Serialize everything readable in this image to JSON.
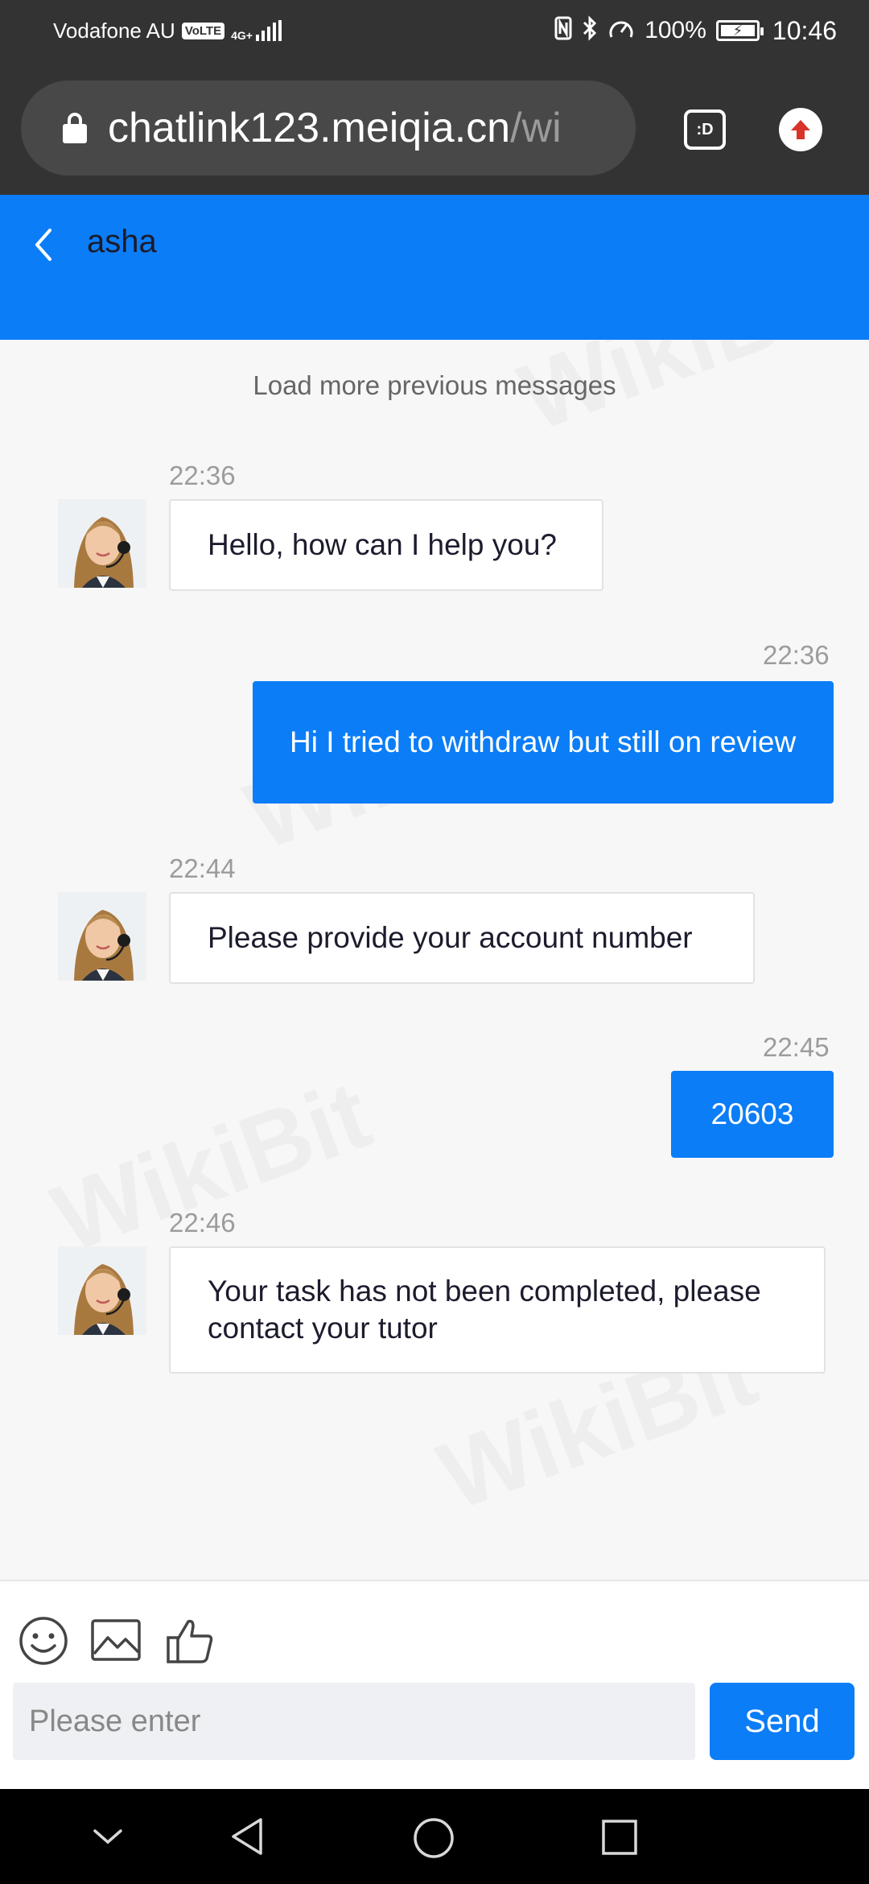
{
  "status_bar": {
    "carrier": "Vodafone AU",
    "volte": "VoLTE",
    "network": "4G+",
    "battery": "100%",
    "time": "10:46"
  },
  "browser": {
    "url_host": "chatlink123.meiqia.cn",
    "url_path": "/wi",
    "tab_label": ":D"
  },
  "header": {
    "title": "asha"
  },
  "chat": {
    "load_more": "Load more previous messages",
    "messages": [
      {
        "from": "agent",
        "time": "22:36",
        "text": "Hello, how can I help you?"
      },
      {
        "from": "user",
        "time": "22:36",
        "text": "Hi I tried to withdraw but still on review"
      },
      {
        "from": "agent",
        "time": "22:44",
        "text": "Please provide your account number"
      },
      {
        "from": "user",
        "time": "22:45",
        "text": "20603"
      },
      {
        "from": "agent",
        "time": "22:46",
        "text": "Your task has not been completed, please contact your tutor"
      }
    ]
  },
  "input": {
    "placeholder": "Please enter",
    "send_label": "Send",
    "tools": [
      "emoji-icon",
      "image-icon",
      "thumbs-up-icon"
    ]
  },
  "watermark": "WikiBit",
  "colors": {
    "brand_blue": "#0b7df7",
    "status_bar": "#333333",
    "background": "#f7f7f7"
  }
}
